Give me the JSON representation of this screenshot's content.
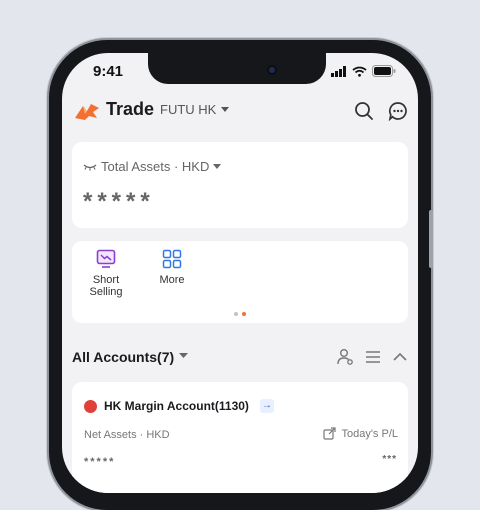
{
  "status_bar": {
    "time": "9:41"
  },
  "header": {
    "title": "Trade",
    "broker": "FUTU HK",
    "icons": [
      "logo-icon",
      "search-icon",
      "chat-icon"
    ]
  },
  "assets": {
    "label": "Total Assets · HKD",
    "masked_value": "*****"
  },
  "tools": [
    {
      "label": "Short Selling",
      "icon": "short-selling-icon"
    },
    {
      "label": "More",
      "icon": "grid-icon"
    }
  ],
  "accounts": {
    "title": "All Accounts(7)"
  },
  "account_card": {
    "name": "HK Margin Account(1130)",
    "net_assets_label": "Net Assets · HKD",
    "todays_pl_label": "Today's P/L",
    "net_assets_masked": "*****",
    "todays_pl_masked": "***"
  },
  "colors": {
    "accent": "#f36f32",
    "link_blue": "#2a6ad8",
    "purple": "#8a3fd1",
    "blue": "#2e79e6"
  }
}
